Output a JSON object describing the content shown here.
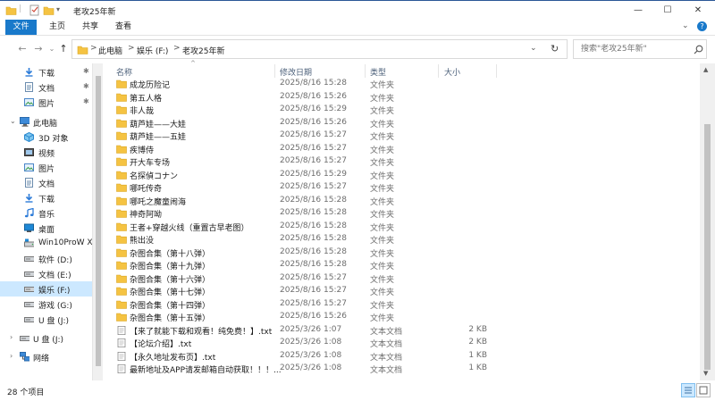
{
  "window": {
    "title": "老攻25年新",
    "minimize": "—",
    "maximize": "☐",
    "close": "✕"
  },
  "ribbon": {
    "tabs": [
      "文件",
      "主页",
      "共享",
      "查看"
    ],
    "collapse": "⌄",
    "help": "?"
  },
  "address": {
    "back": "←",
    "forward": "→",
    "recent": "⌄",
    "up": "↑",
    "crumbs": [
      "此电脑",
      "娱乐 (F:)",
      "老攻25年新"
    ],
    "separator": ">",
    "dropdown": "⌄",
    "refresh": "↻"
  },
  "search": {
    "placeholder": "搜索\"老攻25年新\""
  },
  "nav": {
    "quick_access": [
      {
        "label": "下载",
        "icon": "download-arrow-icon",
        "pin": "📌"
      },
      {
        "label": "文档",
        "icon": "document-icon",
        "pin": "📌"
      },
      {
        "label": "图片",
        "icon": "picture-icon",
        "pin": "📌"
      }
    ],
    "this_pc": {
      "label": "此电脑",
      "items": [
        {
          "label": "3D 对象",
          "icon": "3d-objects-icon"
        },
        {
          "label": "视频",
          "icon": "video-icon"
        },
        {
          "label": "图片",
          "icon": "picture-icon"
        },
        {
          "label": "文档",
          "icon": "document-icon"
        },
        {
          "label": "下载",
          "icon": "download-arrow-icon"
        },
        {
          "label": "音乐",
          "icon": "music-note-icon"
        },
        {
          "label": "桌面",
          "icon": "desktop-icon"
        },
        {
          "label": "Win10ProW X6",
          "icon": "system-drive-icon"
        },
        {
          "label": "软件 (D:)",
          "icon": "drive-icon"
        },
        {
          "label": "文档 (E:)",
          "icon": "drive-icon"
        },
        {
          "label": "娱乐 (F:)",
          "icon": "drive-icon",
          "selected": true
        },
        {
          "label": "游戏 (G:)",
          "icon": "drive-icon"
        },
        {
          "label": "U 盘 (J:)",
          "icon": "usb-drive-icon"
        }
      ]
    },
    "usb": {
      "label": "U 盘 (J:)"
    },
    "network": {
      "label": "网络"
    }
  },
  "columns": {
    "name": "名称",
    "date": "修改日期",
    "type": "类型",
    "size": "大小",
    "sort_arrow": "^"
  },
  "files": [
    {
      "name": "成龙历险记",
      "date": "2025/8/16 15:28",
      "type": "文件夹",
      "size": "",
      "kind": "folder"
    },
    {
      "name": "第五人格",
      "date": "2025/8/16 15:26",
      "type": "文件夹",
      "size": "",
      "kind": "folder"
    },
    {
      "name": "非人哉",
      "date": "2025/8/16 15:29",
      "type": "文件夹",
      "size": "",
      "kind": "folder"
    },
    {
      "name": "葫芦娃——大娃",
      "date": "2025/8/16 15:26",
      "type": "文件夹",
      "size": "",
      "kind": "folder"
    },
    {
      "name": "葫芦娃——五娃",
      "date": "2025/8/16 15:27",
      "type": "文件夹",
      "size": "",
      "kind": "folder"
    },
    {
      "name": "疾博侍",
      "date": "2025/8/16 15:27",
      "type": "文件夹",
      "size": "",
      "kind": "folder"
    },
    {
      "name": "开大车专场",
      "date": "2025/8/16 15:27",
      "type": "文件夹",
      "size": "",
      "kind": "folder"
    },
    {
      "name": "名探偵コナン",
      "date": "2025/8/16 15:29",
      "type": "文件夹",
      "size": "",
      "kind": "folder"
    },
    {
      "name": "哪吒传奇",
      "date": "2025/8/16 15:27",
      "type": "文件夹",
      "size": "",
      "kind": "folder"
    },
    {
      "name": "哪吒之魔童闹海",
      "date": "2025/8/16 15:28",
      "type": "文件夹",
      "size": "",
      "kind": "folder"
    },
    {
      "name": "神奇阿呦",
      "date": "2025/8/16 15:28",
      "type": "文件夹",
      "size": "",
      "kind": "folder"
    },
    {
      "name": "王者+穿越火线（重置古早老图）",
      "date": "2025/8/16 15:28",
      "type": "文件夹",
      "size": "",
      "kind": "folder"
    },
    {
      "name": "熊出没",
      "date": "2025/8/16 15:28",
      "type": "文件夹",
      "size": "",
      "kind": "folder"
    },
    {
      "name": "杂图合集（第十八弹）",
      "date": "2025/8/16 15:28",
      "type": "文件夹",
      "size": "",
      "kind": "folder"
    },
    {
      "name": "杂图合集（第十九弹）",
      "date": "2025/8/16 15:28",
      "type": "文件夹",
      "size": "",
      "kind": "folder"
    },
    {
      "name": "杂图合集（第十六弹）",
      "date": "2025/8/16 15:27",
      "type": "文件夹",
      "size": "",
      "kind": "folder"
    },
    {
      "name": "杂图合集（第十七弹）",
      "date": "2025/8/16 15:27",
      "type": "文件夹",
      "size": "",
      "kind": "folder"
    },
    {
      "name": "杂图合集（第十四弹）",
      "date": "2025/8/16 15:27",
      "type": "文件夹",
      "size": "",
      "kind": "folder"
    },
    {
      "name": "杂图合集（第十五弹）",
      "date": "2025/8/16 15:26",
      "type": "文件夹",
      "size": "",
      "kind": "folder"
    },
    {
      "name": "【来了就能下载和观看！纯免费！】.txt",
      "date": "2025/3/26 1:07",
      "type": "文本文档",
      "size": "2 KB",
      "kind": "text"
    },
    {
      "name": "【论坛介绍】.txt",
      "date": "2025/3/26 1:08",
      "type": "文本文档",
      "size": "2 KB",
      "kind": "text"
    },
    {
      "name": "【永久地址发布页】.txt",
      "date": "2025/3/26 1:08",
      "type": "文本文档",
      "size": "1 KB",
      "kind": "text"
    },
    {
      "name": "最新地址及APP请发邮箱自动获取！！！...",
      "date": "2025/3/26 1:08",
      "type": "文本文档",
      "size": "1 KB",
      "kind": "text"
    }
  ],
  "status": {
    "count": "28 个项目",
    "details_view": "details-view-icon",
    "thumb_view": "large-icons-view-icon"
  },
  "colors": {
    "accent": "#1979ca",
    "folder": "#f5c342",
    "selected": "#cce8ff"
  }
}
